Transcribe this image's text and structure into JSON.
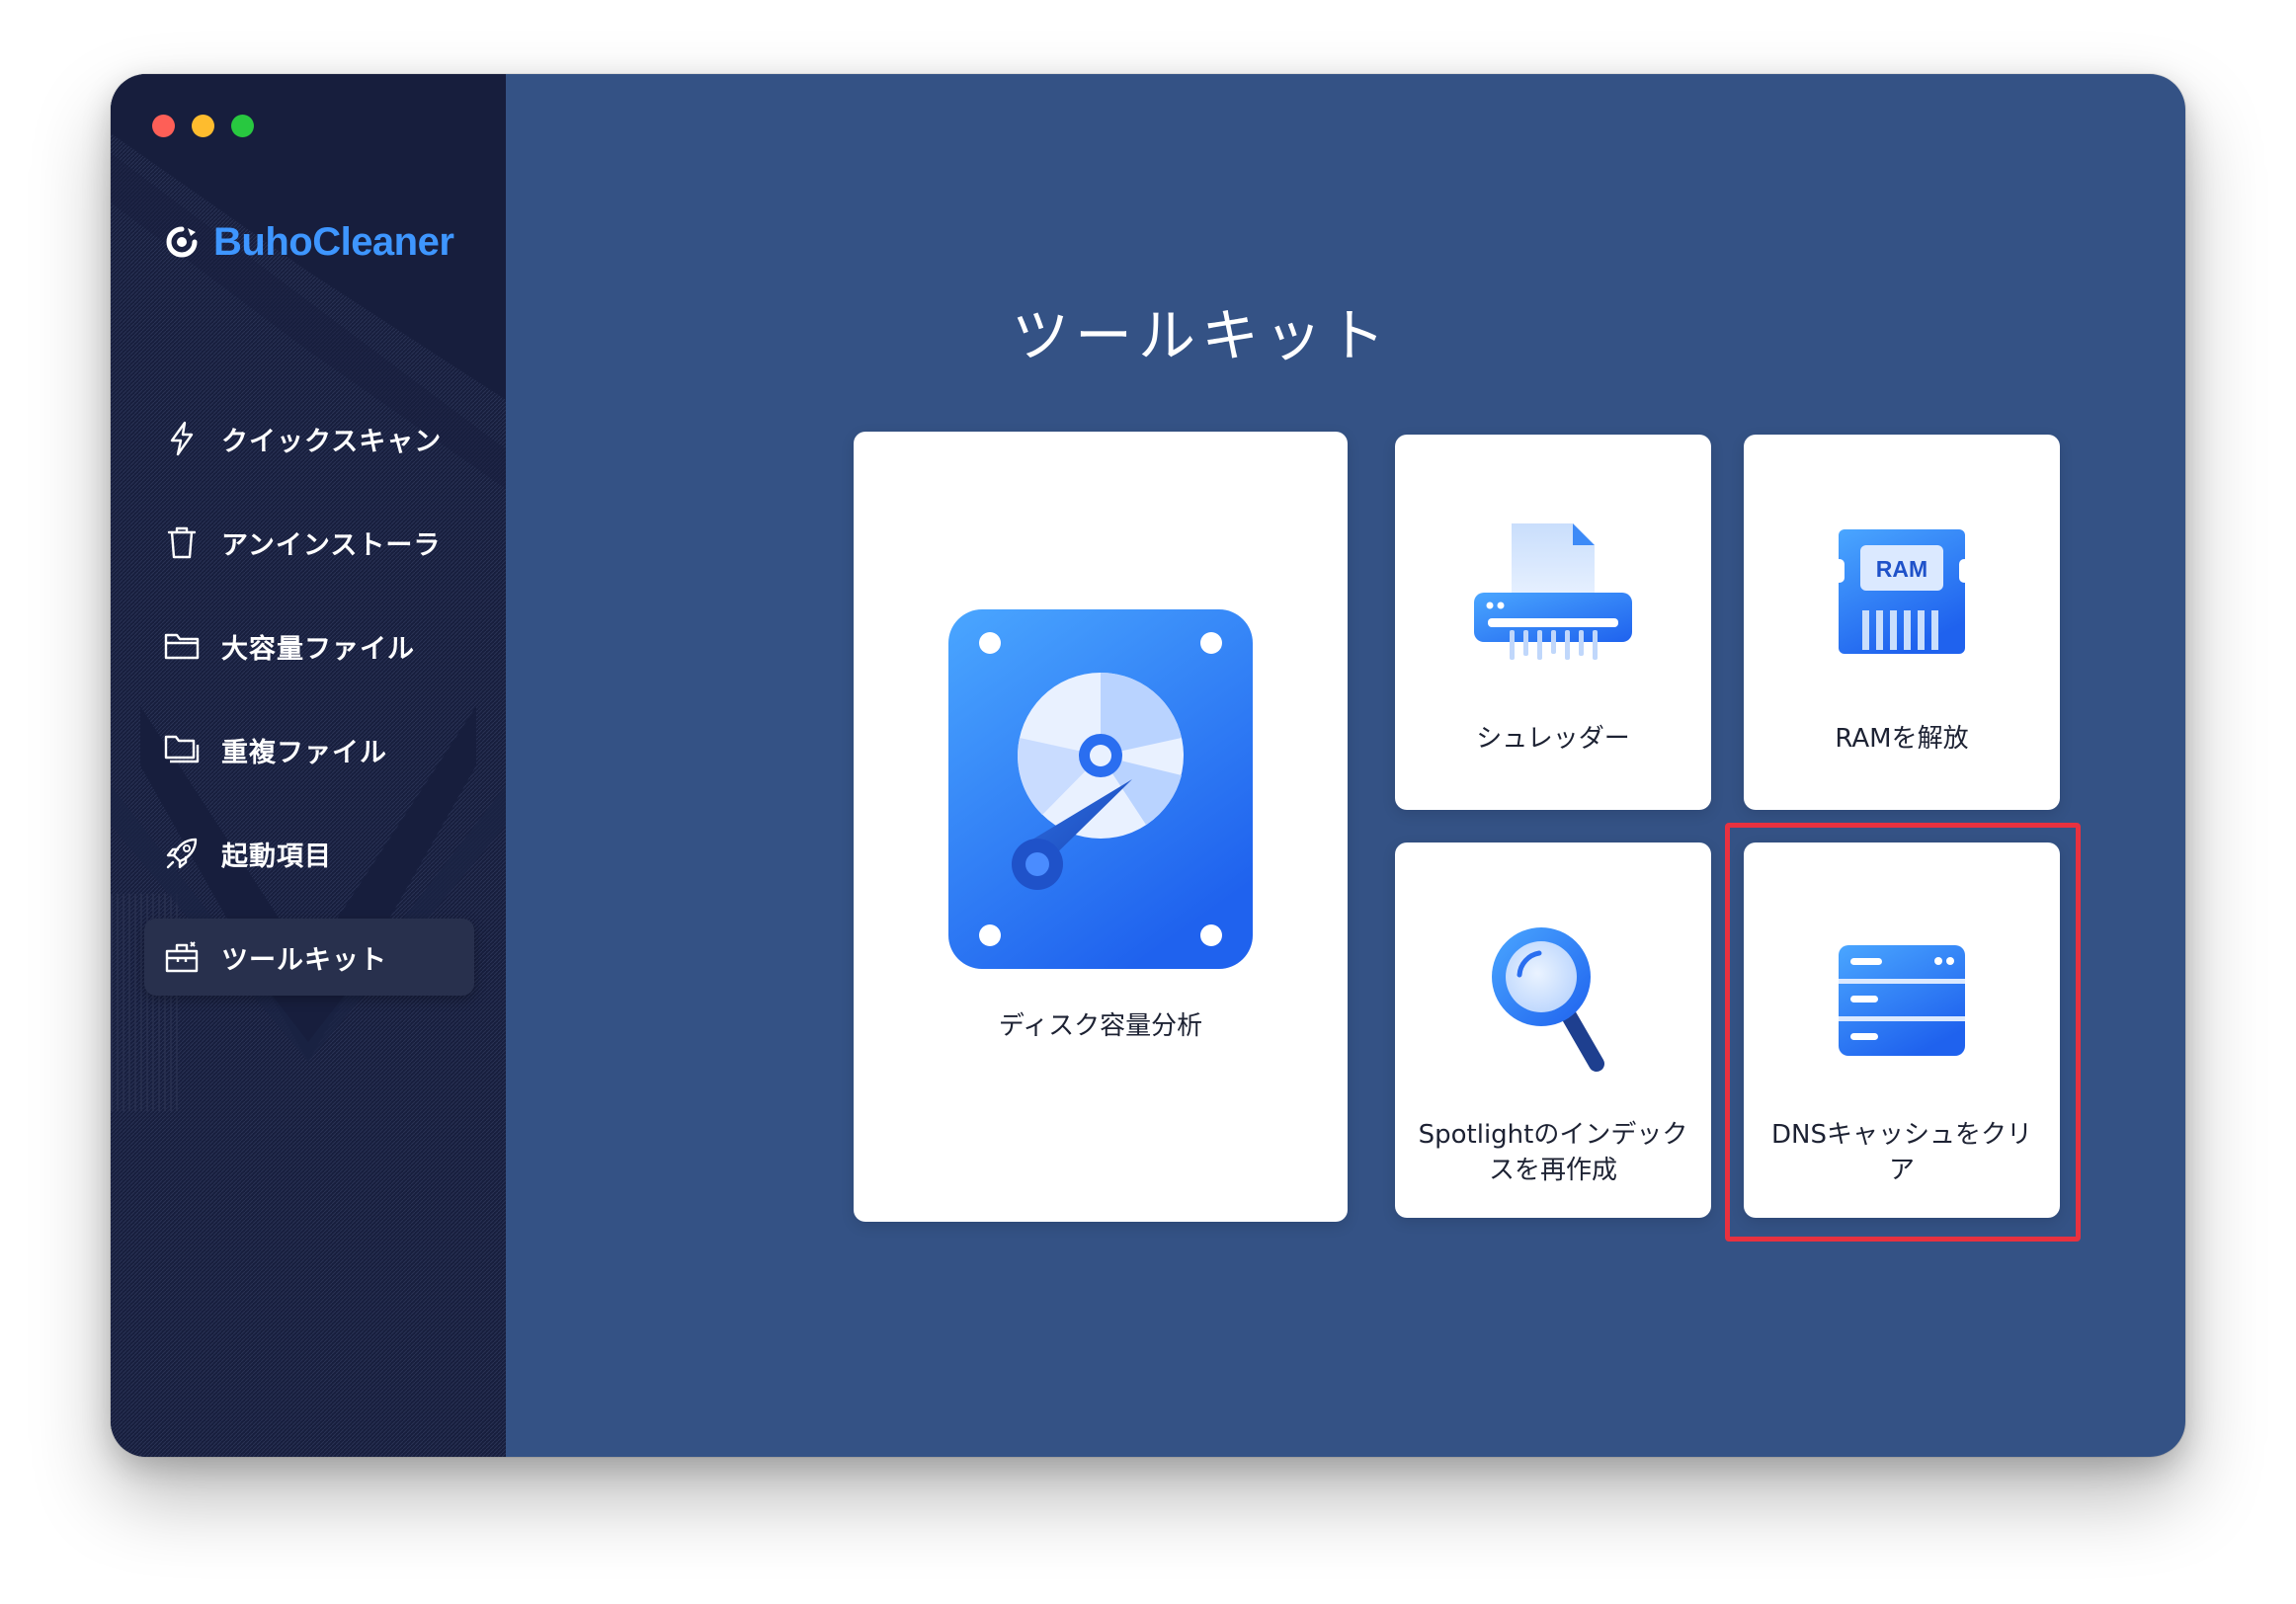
{
  "app": {
    "name": "BuhoCleaner"
  },
  "window_controls": {
    "close": "close",
    "minimize": "minimize",
    "zoom": "zoom"
  },
  "sidebar": {
    "items": [
      {
        "label": "クイックスキャン",
        "icon": "bolt-icon",
        "active": false
      },
      {
        "label": "アンインストーラ",
        "icon": "trash-icon",
        "active": false
      },
      {
        "label": "大容量ファイル",
        "icon": "folder-icon",
        "active": false
      },
      {
        "label": "重複ファイル",
        "icon": "duplicate-folder-icon",
        "active": false
      },
      {
        "label": "起動項目",
        "icon": "rocket-icon",
        "active": false
      },
      {
        "label": "ツールキット",
        "icon": "toolbox-icon",
        "active": true
      }
    ]
  },
  "main": {
    "title": "ツールキット",
    "tools": [
      {
        "label": "ディスク容量分析",
        "icon": "disk-analyzer-icon"
      },
      {
        "label": "シュレッダー",
        "icon": "shredder-icon"
      },
      {
        "label": "RAMを解放",
        "icon": "ram-icon",
        "icon_text": "RAM"
      },
      {
        "label_line1": "Spotlightのインデック",
        "label_line2": "スを再作成",
        "icon": "spotlight-search-icon"
      },
      {
        "label_line1": "DNSキャッシュをクリ",
        "label_line2": "ア",
        "icon": "dns-server-icon",
        "highlighted": true
      }
    ]
  },
  "colors": {
    "sidebar_bg": "#171e3d",
    "main_bg": "#345285",
    "brand": "#3e96ff",
    "icon_blue": "#2a7bf5",
    "highlight": "#e8313f"
  }
}
